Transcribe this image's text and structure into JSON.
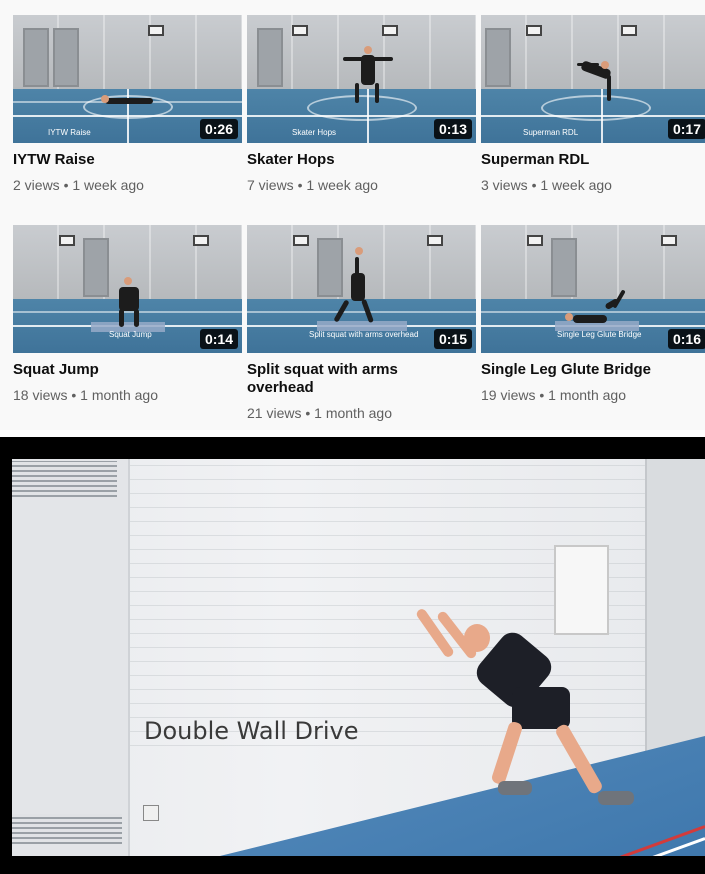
{
  "videos": [
    {
      "title": "IYTW Raise",
      "meta": "2 views • 1 week ago",
      "duration": "0:26",
      "caption": "IYTW Raise"
    },
    {
      "title": "Skater Hops",
      "meta": "7 views • 1 week ago",
      "duration": "0:13",
      "caption": "Skater Hops"
    },
    {
      "title": "Superman RDL",
      "meta": "3 views • 1 week ago",
      "duration": "0:17",
      "caption": "Superman RDL"
    },
    {
      "title": "Squat Jump",
      "meta": "18 views • 1 month ago",
      "duration": "0:14",
      "caption": "Squat Jump"
    },
    {
      "title": "Split squat with arms overhead",
      "meta": "21 views • 1 month ago",
      "duration": "0:15",
      "caption": "Split squat with arms overhead"
    },
    {
      "title": "Single Leg Glute Bridge",
      "meta": "19 views • 1 month ago",
      "duration": "0:16",
      "caption": "Single Leg Glute Bridge"
    }
  ],
  "player": {
    "overlay_text": "Double Wall Drive"
  },
  "colors": {
    "floor": "#3f7399",
    "duration_bg": "#000000",
    "title_text": "#0f0f0f",
    "meta_text": "#606060"
  }
}
